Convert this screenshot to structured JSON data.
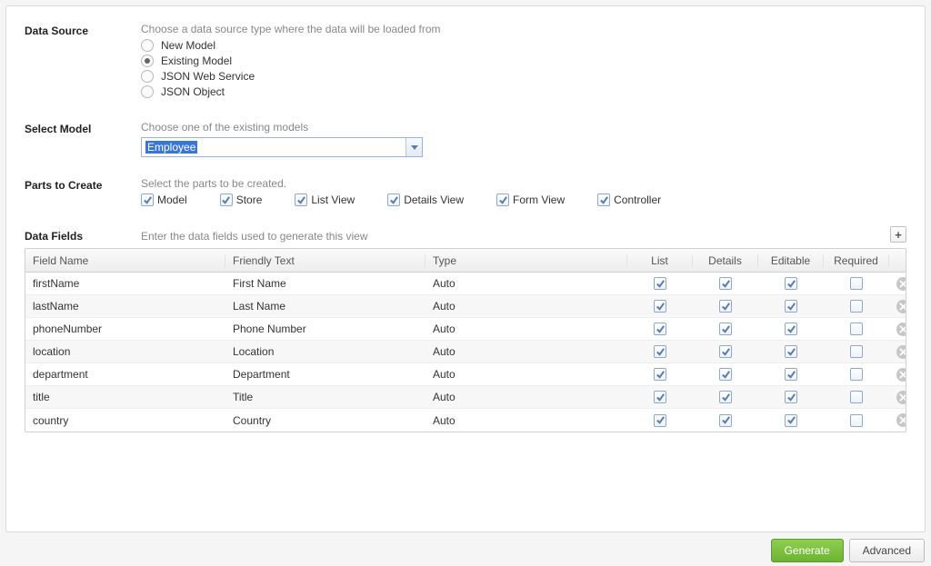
{
  "dataSource": {
    "label": "Data Source",
    "hint": "Choose a data source type where the data will be loaded from",
    "options": [
      {
        "label": "New Model",
        "selected": false
      },
      {
        "label": "Existing Model",
        "selected": true
      },
      {
        "label": "JSON Web Service",
        "selected": false
      },
      {
        "label": "JSON Object",
        "selected": false
      }
    ]
  },
  "selectModel": {
    "label": "Select Model",
    "hint": "Choose one of the existing models",
    "value": "Employee"
  },
  "parts": {
    "label": "Parts to Create",
    "hint": "Select the parts to be created.",
    "items": [
      {
        "label": "Model",
        "checked": true
      },
      {
        "label": "Store",
        "checked": true
      },
      {
        "label": "List View",
        "checked": true
      },
      {
        "label": "Details View",
        "checked": true
      },
      {
        "label": "Form View",
        "checked": true
      },
      {
        "label": "Controller",
        "checked": true
      }
    ]
  },
  "dataFields": {
    "label": "Data Fields",
    "hint": "Enter the data fields used to generate this view",
    "columns": {
      "field": "Field Name",
      "friendly": "Friendly Text",
      "type": "Type",
      "list": "List",
      "details": "Details",
      "editable": "Editable",
      "required": "Required"
    },
    "rows": [
      {
        "field": "firstName",
        "friendly": "First Name",
        "type": "Auto",
        "list": true,
        "details": true,
        "editable": true,
        "required": false
      },
      {
        "field": "lastName",
        "friendly": "Last Name",
        "type": "Auto",
        "list": true,
        "details": true,
        "editable": true,
        "required": false
      },
      {
        "field": "phoneNumber",
        "friendly": "Phone Number",
        "type": "Auto",
        "list": true,
        "details": true,
        "editable": true,
        "required": false
      },
      {
        "field": "location",
        "friendly": "Location",
        "type": "Auto",
        "list": true,
        "details": true,
        "editable": true,
        "required": false
      },
      {
        "field": "department",
        "friendly": "Department",
        "type": "Auto",
        "list": true,
        "details": true,
        "editable": true,
        "required": false
      },
      {
        "field": "title",
        "friendly": "Title",
        "type": "Auto",
        "list": true,
        "details": true,
        "editable": true,
        "required": false
      },
      {
        "field": "country",
        "friendly": "Country",
        "type": "Auto",
        "list": true,
        "details": true,
        "editable": true,
        "required": false
      }
    ]
  },
  "buttons": {
    "generate": "Generate",
    "advanced": "Advanced",
    "add": "+"
  }
}
